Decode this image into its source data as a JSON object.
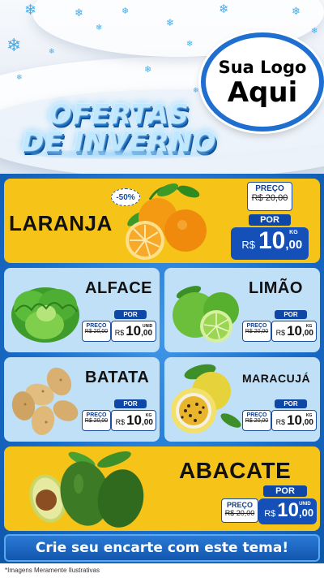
{
  "header": {
    "title_line1": "OFERTAS",
    "title_line2": "DE INVERNO",
    "logo_line1": "Sua Logo",
    "logo_line2": "Aqui"
  },
  "products": {
    "laranja": {
      "name": "LARANJA",
      "discount": "-50%",
      "old_label": "PREÇO",
      "old_price": "R$ 20,00",
      "por_label": "POR",
      "currency": "R$",
      "price_int": "10",
      "price_dec": ",00",
      "unit": "KG"
    },
    "alface": {
      "name": "ALFACE",
      "old_label": "PREÇO",
      "old_price": "R$ 20,00",
      "por_label": "POR",
      "currency": "R$",
      "price_int": "10",
      "price_dec": ",00",
      "unit": "UNID"
    },
    "limao": {
      "name": "LIMÃO",
      "old_label": "PREÇO",
      "old_price": "R$ 20,00",
      "por_label": "POR",
      "currency": "R$",
      "price_int": "10",
      "price_dec": ",00",
      "unit": "KG"
    },
    "batata": {
      "name": "BATATA",
      "old_label": "PREÇO",
      "old_price": "R$ 20,00",
      "por_label": "POR",
      "currency": "R$",
      "price_int": "10",
      "price_dec": ",00",
      "unit": "KG"
    },
    "maracuja": {
      "name": "MARACUJÁ",
      "old_label": "PREÇO",
      "old_price": "R$ 20,00",
      "por_label": "POR",
      "currency": "R$",
      "price_int": "10",
      "price_dec": ",00",
      "unit": "KG"
    },
    "abacate": {
      "name": "ABACATE",
      "old_label": "PREÇO",
      "old_price": "R$ 20,00",
      "por_label": "POR",
      "currency": "R$",
      "price_int": "10",
      "price_dec": ",00",
      "unit": "UNID"
    }
  },
  "footer": {
    "cta": "Crie seu encarte com este tema!",
    "disclaimer": "*Imagens Meramente Ilustrativas"
  },
  "colors": {
    "brand_blue": "#1450b8",
    "accent_yellow": "#f6c419",
    "card_light_blue": "#bfe0f7"
  }
}
